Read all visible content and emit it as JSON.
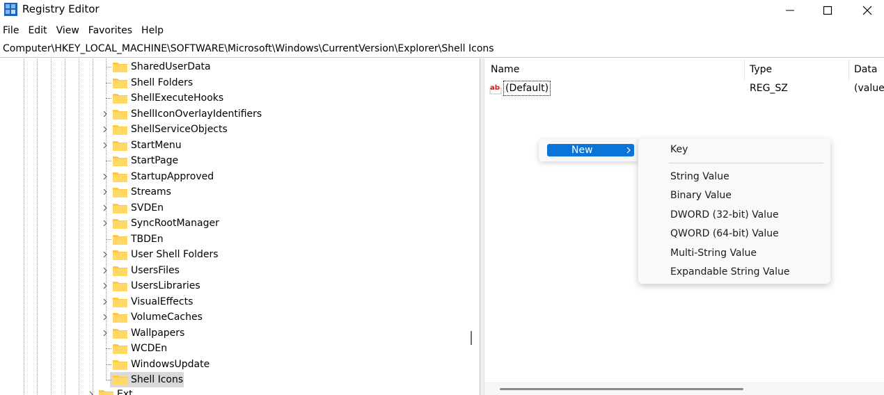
{
  "window": {
    "title": "Registry Editor"
  },
  "menu": [
    "File",
    "Edit",
    "View",
    "Favorites",
    "Help"
  ],
  "address": "Computer\\HKEY_LOCAL_MACHINE\\SOFTWARE\\Microsoft\\Windows\\CurrentVersion\\Explorer\\Shell Icons",
  "tree": {
    "items": [
      {
        "label": "SharedUserData",
        "expandable": false
      },
      {
        "label": "Shell Folders",
        "expandable": false
      },
      {
        "label": "ShellExecuteHooks",
        "expandable": false
      },
      {
        "label": "ShellIconOverlayIdentifiers",
        "expandable": true
      },
      {
        "label": "ShellServiceObjects",
        "expandable": true
      },
      {
        "label": "StartMenu",
        "expandable": true
      },
      {
        "label": "StartPage",
        "expandable": false
      },
      {
        "label": "StartupApproved",
        "expandable": true
      },
      {
        "label": "Streams",
        "expandable": true
      },
      {
        "label": "SVDEn",
        "expandable": true
      },
      {
        "label": "SyncRootManager",
        "expandable": true
      },
      {
        "label": "TBDEn",
        "expandable": false
      },
      {
        "label": "User Shell Folders",
        "expandable": true
      },
      {
        "label": "UsersFiles",
        "expandable": true
      },
      {
        "label": "UsersLibraries",
        "expandable": true
      },
      {
        "label": "VisualEffects",
        "expandable": true
      },
      {
        "label": "VolumeCaches",
        "expandable": true
      },
      {
        "label": "Wallpapers",
        "expandable": true
      },
      {
        "label": "WCDEn",
        "expandable": false
      },
      {
        "label": "WindowsUpdate",
        "expandable": false
      },
      {
        "label": "Shell Icons",
        "expandable": false,
        "selected": true
      }
    ],
    "partial_label": "Ext"
  },
  "values": {
    "headers": {
      "name": "Name",
      "type": "Type",
      "data": "Data"
    },
    "rows": [
      {
        "name": "(Default)",
        "type": "REG_SZ",
        "data": "(value"
      }
    ]
  },
  "context_menu": {
    "new_label": "New",
    "submenu": [
      "Key",
      "String Value",
      "Binary Value",
      "DWORD (32-bit) Value",
      "QWORD (64-bit) Value",
      "Multi-String Value",
      "Expandable String Value"
    ]
  },
  "colors": {
    "accent": "#0a74d8",
    "folder": "#ffc83d",
    "selection": "#d9d9d9"
  }
}
